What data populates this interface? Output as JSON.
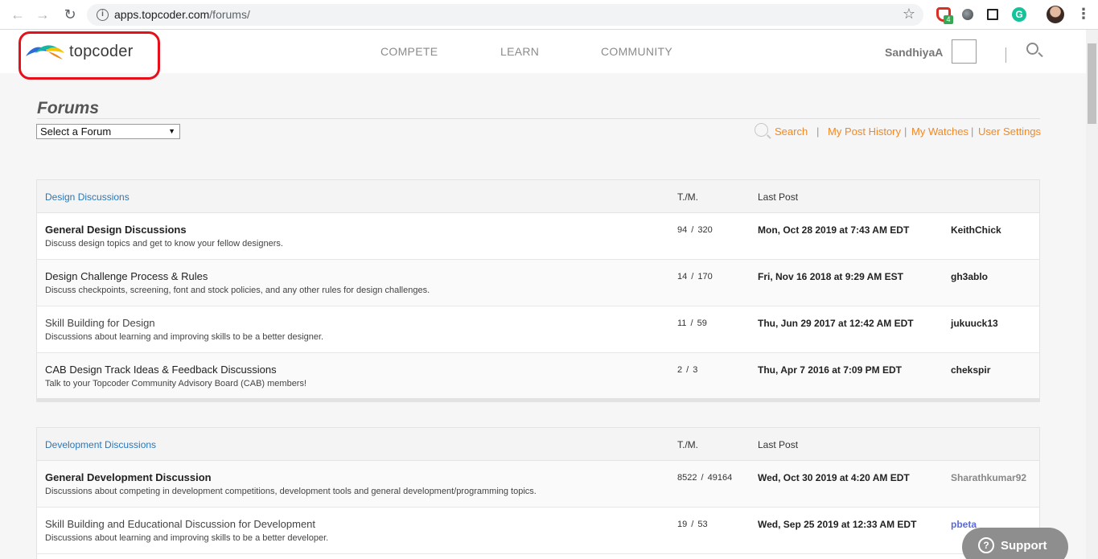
{
  "browser": {
    "url_host": "apps.topcoder.com",
    "url_path": "/forums/",
    "ext_badge": "4",
    "ext_grammarly": "G"
  },
  "header": {
    "logo_text": "topcoder",
    "nav": [
      "COMPETE",
      "LEARN",
      "COMMUNITY"
    ],
    "username": "SandhiyaA"
  },
  "page": {
    "title": "Forums",
    "select_value": "Select a Forum",
    "select_arrow": "▼",
    "toolbar": {
      "search": "Search",
      "sep": "|",
      "history": "My Post History",
      "watches": "My Watches",
      "settings": "User Settings"
    }
  },
  "tables": [
    {
      "category": "Design Discussions",
      "tm_header": "T./M.",
      "last_header": "Last Post",
      "rows": [
        {
          "title": "General Design Discussions",
          "desc": "Discuss design topics and get to know your fellow designers.",
          "tm": "94 / 320",
          "date": "Mon, Oct 28 2019 at 7:43 AM EDT",
          "user": "KeithChick"
        },
        {
          "title": "Design Challenge Process & Rules",
          "desc": "Discuss checkpoints, screening, font and stock policies, and any other rules for design challenges.",
          "tm": "14 / 170",
          "date": "Fri, Nov 16 2018 at 9:29 AM EST",
          "user": "gh3ablo"
        },
        {
          "title": "Skill Building for Design",
          "desc": "Discussions about learning and improving skills to be a better designer.",
          "tm": "11 / 59",
          "date": "Thu, Jun 29 2017 at 12:42 AM EDT",
          "user": "jukuuck13"
        },
        {
          "title": "CAB Design Track Ideas & Feedback Discussions",
          "desc": "Talk to your Topcoder Community Advisory Board (CAB) members!",
          "tm": "2 / 3",
          "date": "Thu, Apr 7 2016 at 7:09 PM EDT",
          "user": "chekspir"
        }
      ]
    },
    {
      "category": "Development Discussions",
      "tm_header": "T./M.",
      "last_header": "Last Post",
      "rows": [
        {
          "title": "General Development Discussion",
          "desc": "Discussions about competing in development competitions, development tools and general development/programming topics.",
          "tm": "8522 / 49164",
          "date": "Wed, Oct 30 2019 at 4:20 AM EDT",
          "user": "Sharathkumar92"
        },
        {
          "title": "Skill Building and Educational Discussion for Development",
          "desc": "Discussions about learning and improving skills to be a better developer.",
          "tm": "19 / 53",
          "date": "Wed, Sep 25 2019 at 12:33 AM EDT",
          "user": "pbeta"
        }
      ]
    }
  ],
  "support": {
    "label": "Support",
    "icon": "?"
  }
}
